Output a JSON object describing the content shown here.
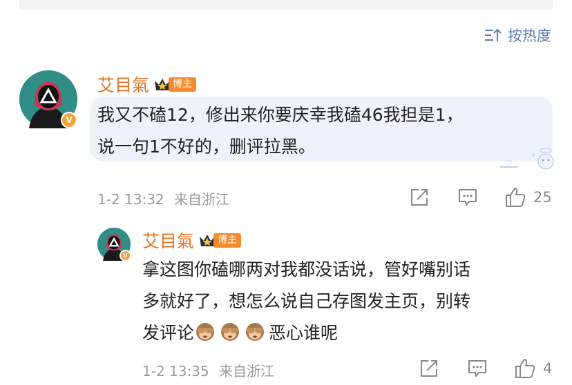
{
  "sort": {
    "label": "按热度"
  },
  "comments": [
    {
      "author": "艾目氣",
      "badge": "博主",
      "verified_mark": "V",
      "text_line1": "我又不磕12，修出来你要庆幸我磕46我担是1，",
      "text_line2": "说一句1不好的，删评拉黑。",
      "time": "1-2 13:32",
      "location": "来自浙江",
      "likes": "25"
    },
    {
      "author": "艾目氣",
      "badge": "博主",
      "verified_mark": "V",
      "text_line1": "拿这图你磕哪两对我都没话说，管好嘴别话",
      "text_line2": "多就好了，想怎么说自己存图发主页，别转",
      "text_line3_prefix": "发评论",
      "text_line3_suffix": "恶心谁呢",
      "time": "1-2 13:35",
      "location": "来自浙江",
      "likes": "4"
    }
  ],
  "colors": {
    "accent": "#e27324",
    "link": "#5a7eb0",
    "bubble": "#eef3fb"
  }
}
